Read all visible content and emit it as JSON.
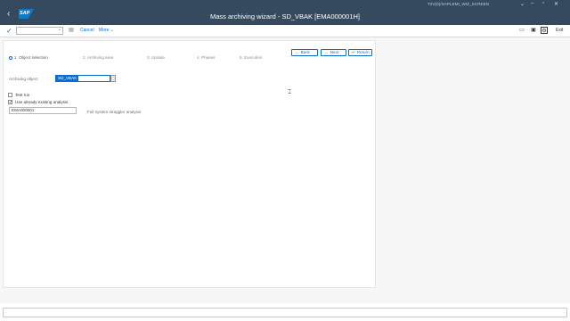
{
  "shell": {
    "title": "Mass archiving wizard - SD_VBAK [EMA000001H]",
    "system_info": "T2V(0)/SAPLEMI_WIZ_SCREEN",
    "back_icon": "chevron-left-icon",
    "logo_text": "SAP"
  },
  "toolbar": {
    "check_icon": "checkmark-icon",
    "command_value": "",
    "cancel_label": "Cancel",
    "more_label": "More",
    "exit_label": "Exit"
  },
  "roadmap": {
    "steps": [
      {
        "label": "1. Object selection",
        "active": true
      },
      {
        "label": "2. Archiving area",
        "active": false
      },
      {
        "label": "3. Update",
        "active": false
      },
      {
        "label": "4. Phases",
        "active": false
      },
      {
        "label": "5. Execution",
        "active": false
      }
    ]
  },
  "nav": {
    "back_label": "Back",
    "next_label": "Next",
    "return_label": "Return"
  },
  "form": {
    "archiving_object_label": "Archiving object",
    "archiving_object_value": "SD_VBAK",
    "test_run_label": "Test run",
    "test_run_checked": false,
    "use_existing_label": "Use already existing analysis",
    "use_existing_checked": true,
    "analysis_value": "EMA000001",
    "analysis_description": "Full system straggler analysis"
  },
  "colors": {
    "shell_bg": "#354a5f",
    "accent": "#0a6ed1",
    "content_bg": "#f7f7f7"
  }
}
